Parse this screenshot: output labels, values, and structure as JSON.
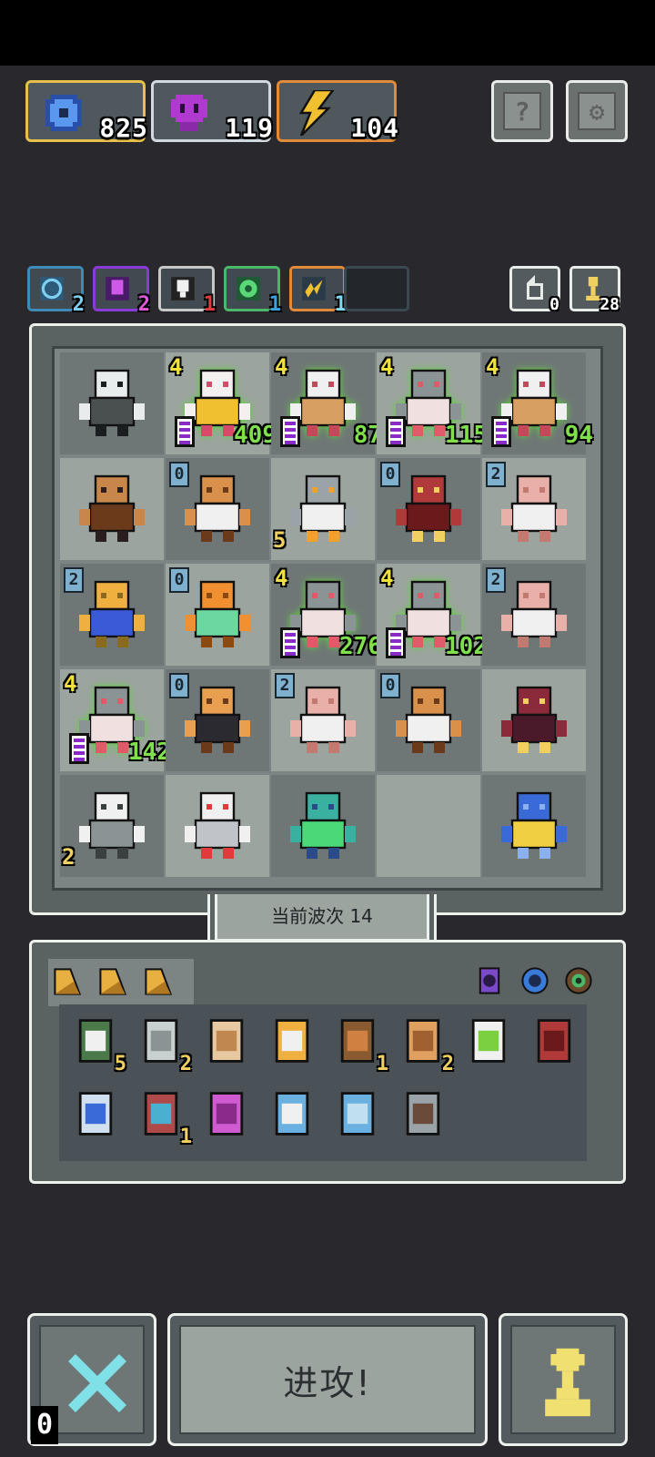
{
  "resources": [
    {
      "name": "blue-gear",
      "value": "825",
      "color": "#e6c04a",
      "icon_color": "#3a78d8"
    },
    {
      "name": "purple-skull",
      "value": "119",
      "color": "#d0d8e0",
      "icon_color": "#c04ad8"
    },
    {
      "name": "lightning",
      "value": "104",
      "color": "#e08a3a",
      "icon_color": "#f0c030"
    }
  ],
  "top_buttons": {
    "help_label": "?",
    "settings_label": "⚙"
  },
  "synergies": [
    {
      "name": "clock",
      "count": "2",
      "border": "#3e8ab8",
      "count_color": "#7fd0f0",
      "icon_color": "#5ab0d8"
    },
    {
      "name": "skull",
      "count": "2",
      "border": "#8a3ad8",
      "count_color": "#e05ad8",
      "icon_color": "#c04ad8"
    },
    {
      "name": "bulb",
      "count": "1",
      "border": "#c8c8c8",
      "count_color": "#e03a3a",
      "icon_color": "#f0f0f0"
    },
    {
      "name": "target",
      "count": "1",
      "border": "#4ab868",
      "count_color": "#3aa0e0",
      "icon_color": "#5ad878"
    },
    {
      "name": "lightning",
      "count": "1",
      "border": "#e08a3a",
      "count_color": "#7fd8f0",
      "icon_color": "#f0c030"
    }
  ],
  "side_counts": {
    "refresh": "0",
    "pawn": "28"
  },
  "board": {
    "rows": [
      [
        {
          "unit": "hooded-reaper",
          "level": "",
          "hp": "",
          "stack": ""
        },
        {
          "unit": "white-haired-girl",
          "level": "4",
          "hp": "409",
          "stack": "",
          "bar": true
        },
        {
          "unit": "paladin-staff",
          "level": "4",
          "hp": "87",
          "stack": "",
          "bar": true
        },
        {
          "unit": "knight",
          "level": "4",
          "hp": "115",
          "stack": "",
          "bar": true
        },
        {
          "unit": "paladin-staff",
          "level": "4",
          "hp": "94",
          "stack": "",
          "bar": true
        }
      ],
      [
        {
          "unit": "brute",
          "level": "",
          "hp": "",
          "stack": ""
        },
        {
          "unit": "bandit",
          "level": "0",
          "hp": "",
          "stack": ""
        },
        {
          "unit": "robot",
          "level": "",
          "hp": "",
          "stack": "5"
        },
        {
          "unit": "red-demon",
          "level": "0",
          "hp": "",
          "stack": ""
        },
        {
          "unit": "mushroom",
          "level": "2",
          "hp": "",
          "stack": ""
        }
      ],
      [
        {
          "unit": "scarab",
          "level": "2",
          "hp": "",
          "stack": ""
        },
        {
          "unit": "chain-link",
          "level": "0",
          "hp": "",
          "stack": ""
        },
        {
          "unit": "knight",
          "level": "4",
          "hp": "276",
          "stack": "",
          "bar": true
        },
        {
          "unit": "knight",
          "level": "4",
          "hp": "102",
          "stack": "",
          "bar": true
        },
        {
          "unit": "mushroom",
          "level": "2",
          "hp": "",
          "stack": ""
        }
      ],
      [
        {
          "unit": "knight",
          "level": "4",
          "hp": "142",
          "stack": "",
          "bar": true
        },
        {
          "unit": "monk",
          "level": "0",
          "hp": "",
          "stack": ""
        },
        {
          "unit": "mushroom",
          "level": "2",
          "hp": "",
          "stack": ""
        },
        {
          "unit": "bandit",
          "level": "0",
          "hp": "",
          "stack": ""
        },
        {
          "unit": "imp",
          "level": "",
          "hp": "",
          "stack": ""
        }
      ],
      [
        {
          "unit": "chef",
          "level": "",
          "hp": "",
          "stack": "2"
        },
        {
          "unit": "ghost",
          "level": "",
          "hp": "",
          "stack": ""
        },
        {
          "unit": "insect",
          "level": "",
          "hp": "",
          "stack": ""
        },
        {
          "unit": "",
          "level": "",
          "hp": "",
          "stack": ""
        },
        {
          "unit": "blue-golem",
          "level": "",
          "hp": "",
          "stack": ""
        }
      ]
    ]
  },
  "wave_label": "当前波次 14",
  "inventory": {
    "tabs": [
      "triangle-card",
      "triangle-card",
      "triangle-card"
    ],
    "orbs": [
      "purple-ring",
      "blue-ring",
      "green-ring"
    ],
    "row1": [
      {
        "name": "goblin-shield",
        "count": "5"
      },
      {
        "name": "scroll",
        "count": "2"
      },
      {
        "name": "bread",
        "count": ""
      },
      {
        "name": "striped-shield",
        "count": ""
      },
      {
        "name": "book",
        "count": "1"
      },
      {
        "name": "bust",
        "count": "2"
      },
      {
        "name": "green-potion",
        "count": ""
      },
      {
        "name": "red-flower",
        "count": ""
      }
    ],
    "row2": [
      {
        "name": "blue-potion",
        "count": ""
      },
      {
        "name": "wand",
        "count": "1"
      },
      {
        "name": "pink-gear",
        "count": ""
      },
      {
        "name": "blue-molecule",
        "count": ""
      },
      {
        "name": "blue-fish",
        "count": ""
      },
      {
        "name": "spike-helmet",
        "count": ""
      }
    ]
  },
  "bottom": {
    "attack_label": "进攻!",
    "skip_count": "0"
  }
}
